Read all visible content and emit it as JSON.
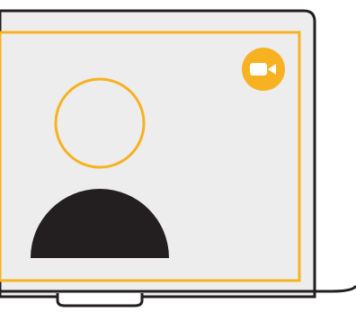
{
  "colors": {
    "accent": "#F7B222",
    "dark": "#231F20",
    "screen_bg": "#EDEDED",
    "page_bg": "#FFFFFF",
    "icon_glyph": "#FFFFFF"
  },
  "icons": {
    "video_call": "video-camera-icon",
    "avatar_head": "avatar-head-outline",
    "avatar_body": "avatar-shoulders"
  }
}
